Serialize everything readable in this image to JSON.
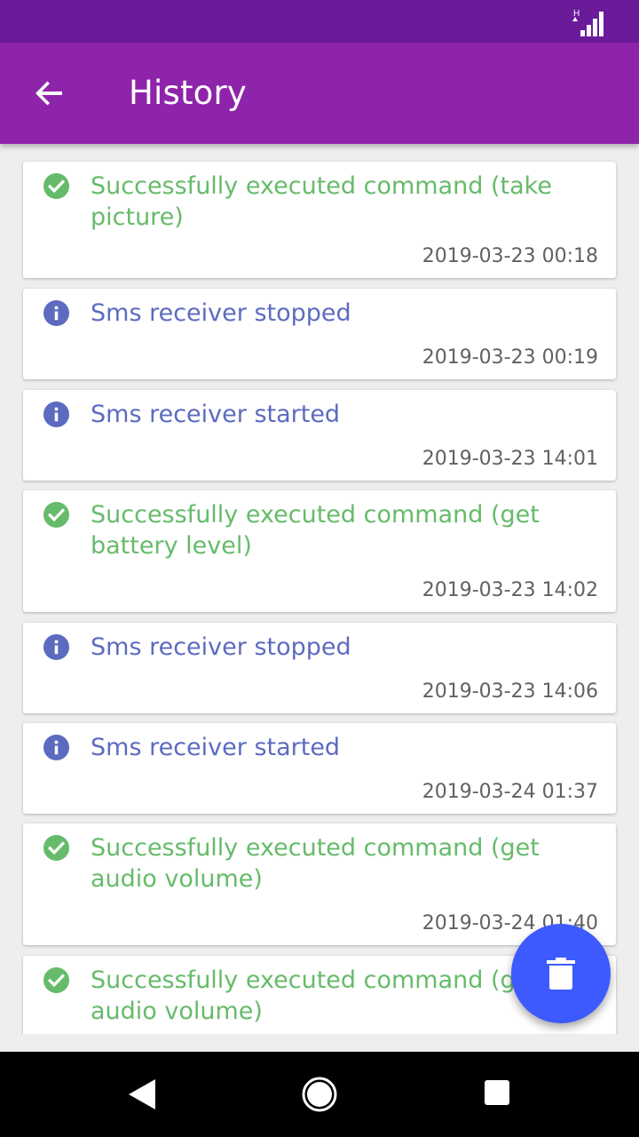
{
  "status_bar": {
    "network_type": "H",
    "signal_icon": "signal-bars-icon"
  },
  "app_bar": {
    "title": "History",
    "back_icon": "arrow-back-icon"
  },
  "colors": {
    "status_bar": "#6a1b9a",
    "app_bar": "#8e24aa",
    "success": "#66bb6a",
    "info": "#5c6bc0",
    "fab": "#3d5afe"
  },
  "history": [
    {
      "type": "success",
      "icon": "check-circle-icon",
      "message": "Successfully executed command (take picture)",
      "time": "2019-03-23 00:18"
    },
    {
      "type": "info",
      "icon": "info-circle-icon",
      "message": "Sms receiver stopped",
      "time": "2019-03-23 00:19"
    },
    {
      "type": "info",
      "icon": "info-circle-icon",
      "message": "Sms receiver started",
      "time": "2019-03-23 14:01"
    },
    {
      "type": "success",
      "icon": "check-circle-icon",
      "message": "Successfully executed command (get battery level)",
      "time": "2019-03-23 14:02"
    },
    {
      "type": "info",
      "icon": "info-circle-icon",
      "message": "Sms receiver stopped",
      "time": "2019-03-23 14:06"
    },
    {
      "type": "info",
      "icon": "info-circle-icon",
      "message": "Sms receiver started",
      "time": "2019-03-24 01:37"
    },
    {
      "type": "success",
      "icon": "check-circle-icon",
      "message": "Successfully executed command (get audio volume)",
      "time": "2019-03-24 01:40"
    },
    {
      "type": "success",
      "icon": "check-circle-icon",
      "message": "Successfully executed command (get audio volume)",
      "time": ""
    }
  ],
  "fab": {
    "icon": "trash-icon"
  },
  "nav_bar": {
    "back_icon": "nav-back-icon",
    "home_icon": "nav-home-icon",
    "recents_icon": "nav-recents-icon"
  }
}
